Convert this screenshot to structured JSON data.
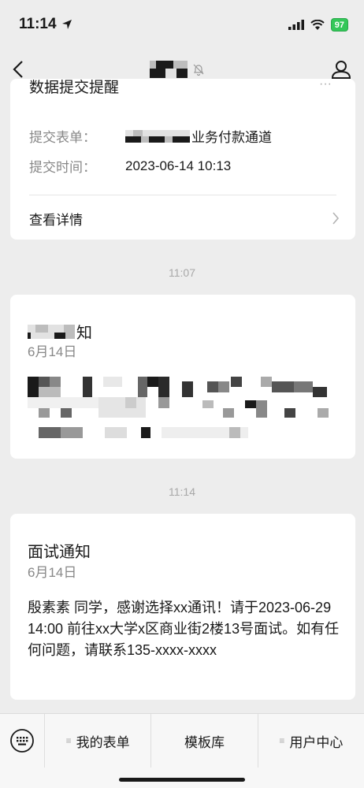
{
  "status": {
    "time": "11:14",
    "battery": "97"
  },
  "nav": {
    "back_icon": "chevron-left-icon",
    "mute_icon": "bell-slash-icon",
    "profile_icon": "person-icon"
  },
  "card1": {
    "title": "数据提交提醒",
    "form_label": "提交表单：",
    "form_value_suffix": "业务付款通道",
    "time_label": "提交时间：",
    "time_value": "2023-06-14 10:13",
    "detail_label": "查看详情"
  },
  "sep1": "11:07",
  "card2": {
    "title_suffix": "知",
    "date": "6月14日"
  },
  "sep2": "11:14",
  "card3": {
    "title": "面试通知",
    "date": "6月14日",
    "body": "殷素素 同学，感谢选择xx通讯！请于2023-06-29 14:00  前往xx大学x区商业街2楼13号面试。如有任何问题，请联系135-xxxx-xxxx"
  },
  "menu": [
    {
      "label": "我的表单",
      "has_dot": true
    },
    {
      "label": "模板库",
      "has_dot": false
    },
    {
      "label": "用户中心",
      "has_dot": true
    }
  ]
}
